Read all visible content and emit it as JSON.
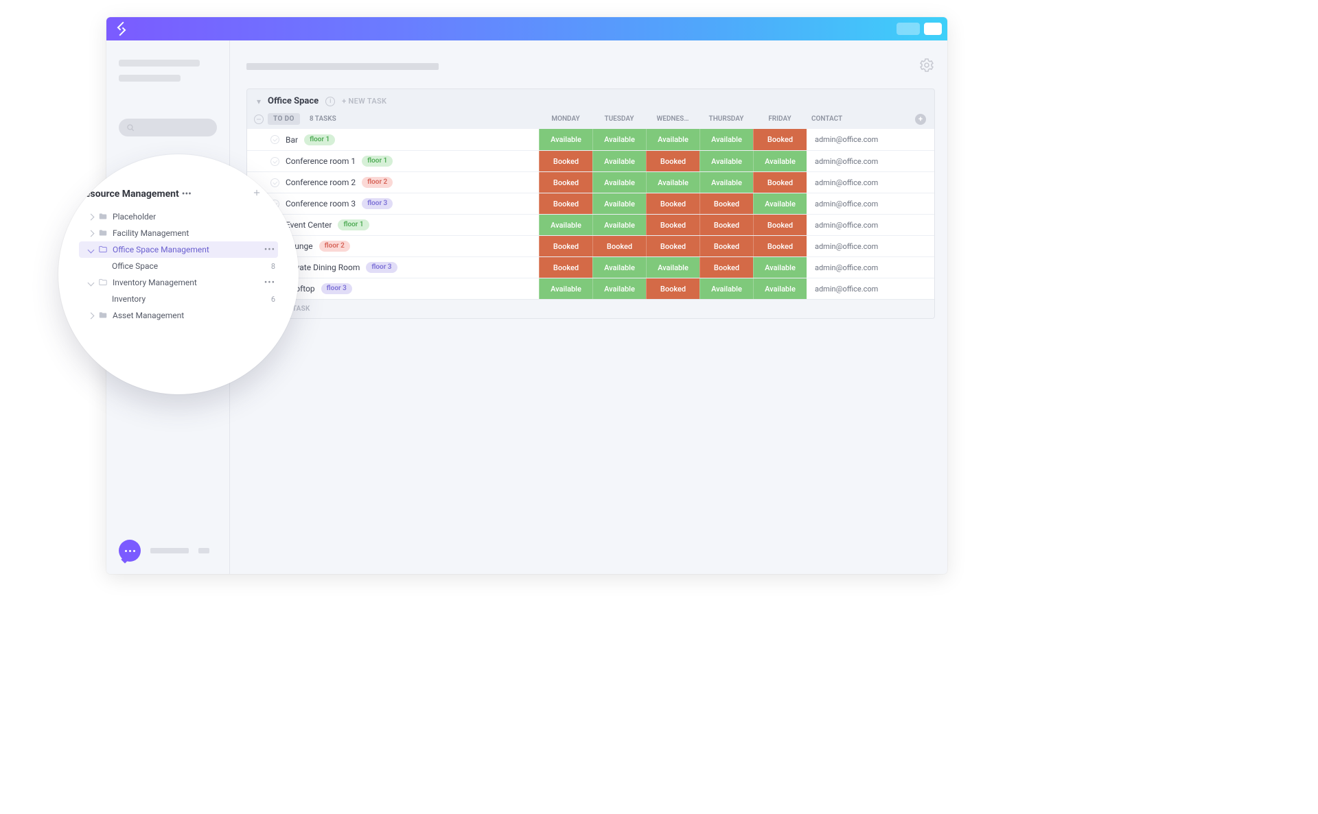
{
  "panel": {
    "title": "Office Space",
    "new_task": "+ NEW TASK",
    "status_chip": "TO DO",
    "task_count": "8 TASKS",
    "add_task": "+ ADD TASK"
  },
  "columns": {
    "days": [
      "MONDAY",
      "TUESDAY",
      "WEDNES…",
      "THURSDAY",
      "FRIDAY"
    ],
    "contact": "CONTACT"
  },
  "rows": [
    {
      "name": "Bar",
      "tag": {
        "text": "floor 1",
        "variant": "green"
      },
      "cells": [
        "Available",
        "Available",
        "Available",
        "Available",
        "Booked"
      ],
      "contact": "admin@office.com"
    },
    {
      "name": "Conference room 1",
      "tag": {
        "text": "floor 1",
        "variant": "green"
      },
      "cells": [
        "Booked",
        "Available",
        "Booked",
        "Available",
        "Available"
      ],
      "contact": "admin@office.com"
    },
    {
      "name": "Conference room 2",
      "tag": {
        "text": "floor 2",
        "variant": "red"
      },
      "cells": [
        "Booked",
        "Available",
        "Available",
        "Available",
        "Booked"
      ],
      "contact": "admin@office.com"
    },
    {
      "name": "Conference room 3",
      "tag": {
        "text": "floor 3",
        "variant": "purple"
      },
      "cells": [
        "Booked",
        "Available",
        "Booked",
        "Booked",
        "Available"
      ],
      "contact": "admin@office.com"
    },
    {
      "name": "Event Center",
      "tag": {
        "text": "floor 1",
        "variant": "green"
      },
      "cells": [
        "Available",
        "Available",
        "Booked",
        "Booked",
        "Booked"
      ],
      "contact": "admin@office.com"
    },
    {
      "name": "Lounge",
      "tag": {
        "text": "floor 2",
        "variant": "red"
      },
      "cells": [
        "Booked",
        "Booked",
        "Booked",
        "Booked",
        "Booked"
      ],
      "contact": "admin@office.com"
    },
    {
      "name": "Private Dining Room",
      "tag": {
        "text": "floor 3",
        "variant": "purple"
      },
      "cells": [
        "Booked",
        "Available",
        "Available",
        "Booked",
        "Available"
      ],
      "contact": "admin@office.com"
    },
    {
      "name": "Rooftop",
      "tag": {
        "text": "floor 3",
        "variant": "purple"
      },
      "cells": [
        "Available",
        "Available",
        "Booked",
        "Available",
        "Available"
      ],
      "contact": "admin@office.com"
    }
  ],
  "lens": {
    "title": "Resource Management",
    "items": [
      {
        "kind": "folder",
        "label": "Placeholder",
        "indent": 1,
        "caret": "right"
      },
      {
        "kind": "folder",
        "label": "Facility Management",
        "indent": 1,
        "caret": "right"
      },
      {
        "kind": "list",
        "label": "Office Space Management",
        "indent": 1,
        "caret": "down",
        "active": true,
        "more": true
      },
      {
        "kind": "leaf",
        "label": "Office Space",
        "indent": 2,
        "count": "8"
      },
      {
        "kind": "list",
        "label": "Inventory Management",
        "indent": 1,
        "caret": "down",
        "more": true
      },
      {
        "kind": "leaf",
        "label": "Inventory",
        "indent": 2,
        "count": "6"
      },
      {
        "kind": "folder",
        "label": "Asset Management",
        "indent": 1,
        "caret": "right"
      }
    ]
  }
}
